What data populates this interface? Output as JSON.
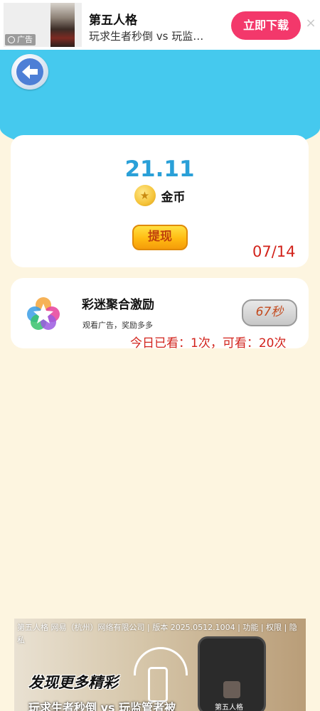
{
  "ad_banner": {
    "tag": "广告",
    "title": "第五人格",
    "subtitle": "玩求生者秒倒 vs 玩监…",
    "cta": "立即下载",
    "close": "×"
  },
  "balance": {
    "value": "21.11",
    "coin_label": "金币",
    "withdraw": "提现",
    "date": "07/14"
  },
  "reward": {
    "title": "彩迷聚合激励",
    "subtitle": "观看广告，奖励多多",
    "timer": "67秒",
    "count": "今日已看：1次，可看：20次"
  },
  "bottom_ad": {
    "meta": "第五人格 网易（杭州）网络有限公司 | 版本 2025.0512.1004 | 功能 | 权限 | 隐私",
    "headline": "发现更多精彩",
    "subline": "玩求生者秒倒 vs 玩监管者被",
    "app_label": "第五人格"
  },
  "colors": {
    "header": "#45c9ee",
    "background": "#fdf5e0",
    "accent_red": "#d2231b",
    "cta_pink": "#f3386b",
    "value_blue": "#2aa0d8"
  }
}
